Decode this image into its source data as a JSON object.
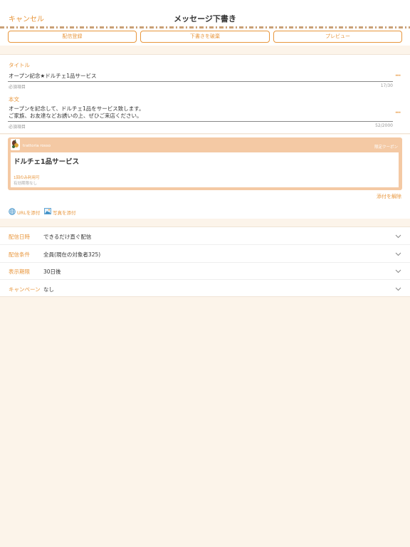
{
  "nav": {
    "cancel": "キャンセル",
    "title": "メッセージ下書き"
  },
  "toolbar": {
    "register": "配信登録",
    "discard": "下書きを破棄",
    "preview": "プレビュー"
  },
  "form": {
    "title_label": "タイトル",
    "title_value": "オープン記念★ドルチェ1品サービス",
    "title_hint": "必須項目",
    "title_count": "17/30",
    "body_label": "本文",
    "body_line1": "オープンを記念して、ドルチェ1品をサービス致します。",
    "body_line2": "ご家族、お友達などお誘いの上、ぜひご来店ください。",
    "body_hint": "必須項目",
    "body_count": "52/2000"
  },
  "coupon": {
    "store": "trattoria rosso",
    "tag": "限定クーポン",
    "name": "ドルチェ1品サービス",
    "limit": "1回のみ利用可",
    "expiry": "有効期限なし",
    "detach": "添付を解除"
  },
  "attach": {
    "url": "URLを添付",
    "photo": "写真を添付"
  },
  "settings": [
    {
      "label": "配信日時",
      "value": "できるだけ直ぐ配信"
    },
    {
      "label": "配信条件",
      "value": "全員(現在の対象者325)"
    },
    {
      "label": "表示期限",
      "value": "30日後"
    },
    {
      "label": "キャンペーン",
      "value": "なし"
    }
  ],
  "colors": {
    "accent": "#e8963c",
    "coupon_header": "#f4c9a4",
    "page_bg": "#fcf4ea"
  },
  "icons": {
    "url": "globe-icon",
    "photo": "image-icon",
    "more": "ellipsis-icon",
    "chevron": "chevron-down-icon"
  }
}
